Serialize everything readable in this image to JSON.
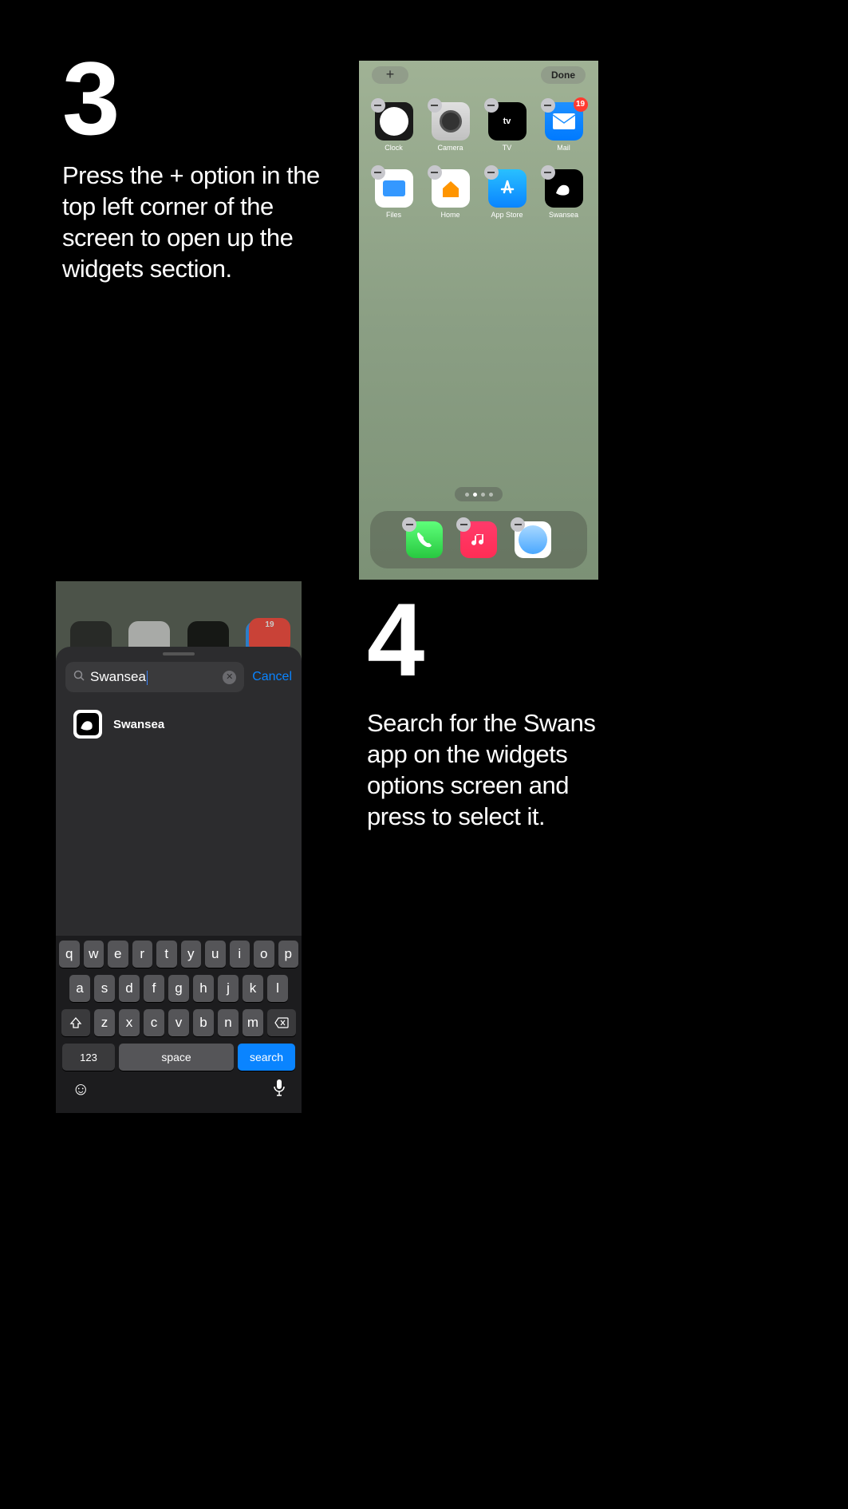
{
  "step3": {
    "number": "3",
    "text": "Press the + option in the top left corner of the screen to open up the widgets section."
  },
  "step4": {
    "number": "4",
    "text": "Search for the Swans app on the widgets options screen and press to select it."
  },
  "phone1": {
    "add_label": "+",
    "done_label": "Done",
    "apps": [
      {
        "label": "Clock"
      },
      {
        "label": "Camera"
      },
      {
        "label": "TV"
      },
      {
        "label": "Mail",
        "badge": "19"
      },
      {
        "label": "Files"
      },
      {
        "label": "Home"
      },
      {
        "label": "App Store"
      },
      {
        "label": "Swansea"
      }
    ],
    "dock": [
      "Phone",
      "Music",
      "Safari"
    ]
  },
  "phone2": {
    "search_value": "Swansea",
    "cancel_label": "Cancel",
    "result_label": "Swansea",
    "bg_badge": "19",
    "keyboard": {
      "row1": [
        "q",
        "w",
        "e",
        "r",
        "t",
        "y",
        "u",
        "i",
        "o",
        "p"
      ],
      "row2": [
        "a",
        "s",
        "d",
        "f",
        "g",
        "h",
        "j",
        "k",
        "l"
      ],
      "row3": [
        "z",
        "x",
        "c",
        "v",
        "b",
        "n",
        "m"
      ],
      "num_label": "123",
      "space_label": "space",
      "search_label": "search"
    }
  }
}
